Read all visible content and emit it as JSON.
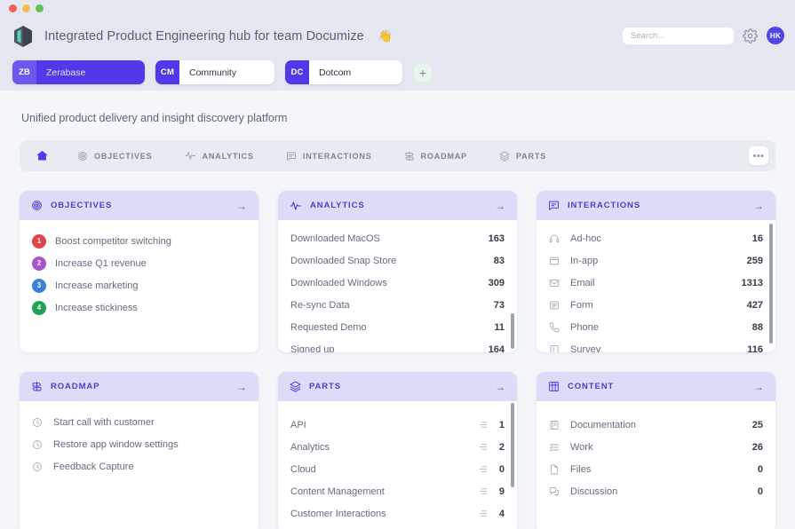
{
  "window": {
    "dots": [
      "close",
      "minimize",
      "maximize"
    ]
  },
  "header": {
    "logo_icon": "cube-logo-icon",
    "title": "Integrated Product Engineering hub for team Documize",
    "emoji": "👋",
    "search": {
      "placeholder": "Search...",
      "value": ""
    },
    "gear_icon": "gear-icon",
    "avatar_initials": "HK",
    "spaces": [
      {
        "initials": "ZB",
        "name": "Zerabase",
        "active": true
      },
      {
        "initials": "CM",
        "name": "Community",
        "active": false
      },
      {
        "initials": "DC",
        "name": "Dotcom",
        "active": false
      }
    ],
    "add_space_label": "+"
  },
  "subtitle": "Unified product delivery and insight discovery platform",
  "tabs": {
    "more_label": "•••",
    "items": [
      {
        "label": "",
        "icon": "home-icon",
        "active": true
      },
      {
        "label": "OBJECTIVES",
        "icon": "target-icon",
        "active": false
      },
      {
        "label": "ANALYTICS",
        "icon": "activity-icon",
        "active": false
      },
      {
        "label": "INTERACTIONS",
        "icon": "message-icon",
        "active": false
      },
      {
        "label": "ROADMAP",
        "icon": "signpost-icon",
        "active": false
      },
      {
        "label": "PARTS",
        "icon": "layers-icon",
        "active": false
      }
    ]
  },
  "cards": [
    {
      "title": "OBJECTIVES",
      "icon": "target-icon",
      "arrow": "→",
      "style": "numbered",
      "rows": [
        {
          "label": "Boost competitor switching",
          "num": "1",
          "color": "#e0444a"
        },
        {
          "label": "Increase Q1 revenue",
          "num": "2",
          "color": "#a855cc"
        },
        {
          "label": "Increase marketing",
          "num": "3",
          "color": "#3b82d6"
        },
        {
          "label": "Increase stickiness",
          "num": "4",
          "color": "#22a055"
        }
      ]
    },
    {
      "title": "ANALYTICS",
      "icon": "activity-icon",
      "arrow": "→",
      "style": "plain",
      "scroll": true,
      "rows": [
        {
          "label": "Downloaded MacOS",
          "value": "163"
        },
        {
          "label": "Downloaded Snap Store",
          "value": "83"
        },
        {
          "label": "Downloaded Windows",
          "value": "309"
        },
        {
          "label": "Re-sync Data",
          "value": "73"
        },
        {
          "label": "Requested Demo",
          "value": "11"
        },
        {
          "label": "Signed up",
          "value": "164"
        }
      ]
    },
    {
      "title": "INTERACTIONS",
      "icon": "message-icon",
      "arrow": "→",
      "style": "icon",
      "scroll": true,
      "rows": [
        {
          "label": "Ad-hoc",
          "value": "16",
          "icon": "headphones-icon"
        },
        {
          "label": "In-app",
          "value": "259",
          "icon": "window-icon"
        },
        {
          "label": "Email",
          "value": "1313",
          "icon": "envelope-icon"
        },
        {
          "label": "Form",
          "value": "427",
          "icon": "form-icon"
        },
        {
          "label": "Phone",
          "value": "88",
          "icon": "phone-icon"
        },
        {
          "label": "Survey",
          "value": "116",
          "icon": "survey-icon"
        }
      ]
    },
    {
      "title": "ROADMAP",
      "icon": "signpost-icon",
      "arrow": "→",
      "style": "icon",
      "rows": [
        {
          "label": "Start call with customer",
          "value": "",
          "icon": "clock-icon"
        },
        {
          "label": "Restore app window settings",
          "value": "",
          "icon": "clock-icon"
        },
        {
          "label": "Feedback Capture",
          "value": "",
          "icon": "clock-icon"
        }
      ]
    },
    {
      "title": "PARTS",
      "icon": "layers-icon",
      "arrow": "→",
      "style": "counted",
      "scroll": true,
      "rows": [
        {
          "label": "API",
          "value": "1"
        },
        {
          "label": "Analytics",
          "value": "2"
        },
        {
          "label": "Cloud",
          "value": "0"
        },
        {
          "label": "Content Management",
          "value": "9"
        },
        {
          "label": "Customer Interactions",
          "value": "4"
        }
      ]
    },
    {
      "title": "CONTENT",
      "icon": "grid-icon",
      "arrow": "→",
      "style": "icon",
      "rows": [
        {
          "label": "Documentation",
          "value": "25",
          "icon": "document-icon"
        },
        {
          "label": "Work",
          "value": "26",
          "icon": "tasklist-icon"
        },
        {
          "label": "Files",
          "value": "0",
          "icon": "file-icon"
        },
        {
          "label": "Discussion",
          "value": "0",
          "icon": "chat-icon"
        }
      ]
    }
  ],
  "colors": {
    "accent": "#4f39e8",
    "card_header_bg": "#dcdcf9",
    "page_bg": "#f4f6fa",
    "chrome_bg": "#e4e7ef"
  }
}
